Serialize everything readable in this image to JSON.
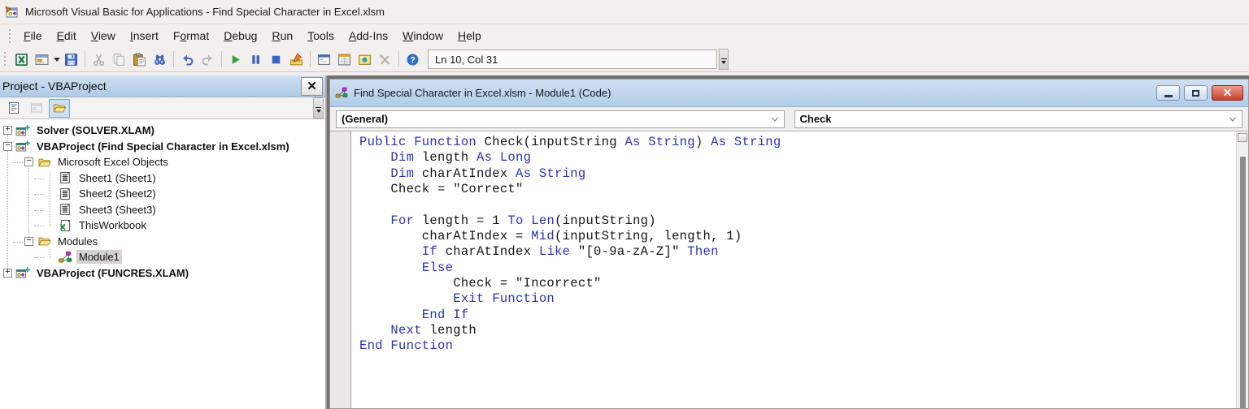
{
  "window": {
    "title": "Microsoft Visual Basic for Applications - Find Special Character in Excel.xlsm"
  },
  "menu": {
    "items": [
      {
        "label": "File",
        "mnemonic": 0
      },
      {
        "label": "Edit",
        "mnemonic": 0
      },
      {
        "label": "View",
        "mnemonic": 0
      },
      {
        "label": "Insert",
        "mnemonic": 0
      },
      {
        "label": "Format",
        "mnemonic": 1
      },
      {
        "label": "Debug",
        "mnemonic": 0
      },
      {
        "label": "Run",
        "mnemonic": 0
      },
      {
        "label": "Tools",
        "mnemonic": 0
      },
      {
        "label": "Add-Ins",
        "mnemonic": 0
      },
      {
        "label": "Window",
        "mnemonic": 0
      },
      {
        "label": "Help",
        "mnemonic": 0
      }
    ]
  },
  "toolbar": {
    "position_indicator": "Ln 10, Col 31",
    "buttons": [
      {
        "name": "view-excel",
        "icon": "excel",
        "enabled": true
      },
      {
        "name": "insert-userform",
        "icon": "userform",
        "enabled": true,
        "dropdown": true
      },
      {
        "name": "save",
        "icon": "save",
        "enabled": true
      },
      {
        "sep": true
      },
      {
        "name": "cut",
        "icon": "cut",
        "enabled": false
      },
      {
        "name": "copy",
        "icon": "copy",
        "enabled": false
      },
      {
        "name": "paste",
        "icon": "paste",
        "enabled": true
      },
      {
        "name": "find",
        "icon": "find",
        "enabled": true
      },
      {
        "sep": true
      },
      {
        "name": "undo",
        "icon": "undo",
        "enabled": true
      },
      {
        "name": "redo",
        "icon": "redo",
        "enabled": false
      },
      {
        "sep": true
      },
      {
        "name": "run-macro",
        "icon": "run",
        "enabled": true
      },
      {
        "name": "break",
        "icon": "break",
        "enabled": true
      },
      {
        "name": "reset",
        "icon": "stop",
        "enabled": true
      },
      {
        "name": "design-mode",
        "icon": "design",
        "enabled": true
      },
      {
        "sep": true
      },
      {
        "name": "project-explorer",
        "icon": "projexp",
        "enabled": true
      },
      {
        "name": "properties-window",
        "icon": "props",
        "enabled": true
      },
      {
        "name": "object-browser",
        "icon": "objbrowser",
        "enabled": true
      },
      {
        "name": "toolbox",
        "icon": "toolbox",
        "enabled": false
      },
      {
        "sep": true
      },
      {
        "name": "help",
        "icon": "help",
        "enabled": true
      }
    ]
  },
  "project_panel": {
    "header": {
      "title": "Project - VBAProject"
    },
    "toolbar": {
      "buttons": [
        {
          "name": "view-code",
          "icon": "viewcode",
          "enabled": true,
          "active": false
        },
        {
          "name": "view-object",
          "icon": "viewobject",
          "enabled": false,
          "active": false
        },
        {
          "name": "toggle-folders",
          "icon": "folder",
          "enabled": true,
          "active": true
        }
      ]
    },
    "tree": [
      {
        "depth": 0,
        "expand": "+",
        "icon": "project",
        "label": "Solver (SOLVER.XLAM)",
        "bold": true
      },
      {
        "depth": 0,
        "expand": "-",
        "icon": "project",
        "label": "VBAProject (Find Special Character in Excel.xlsm)",
        "bold": true
      },
      {
        "depth": 1,
        "expand": "-",
        "icon": "folder",
        "label": "Microsoft Excel Objects",
        "bold": false
      },
      {
        "depth": 2,
        "expand": "",
        "icon": "sheet",
        "label": "Sheet1 (Sheet1)",
        "bold": false
      },
      {
        "depth": 2,
        "expand": "",
        "icon": "sheet",
        "label": "Sheet2 (Sheet2)",
        "bold": false
      },
      {
        "depth": 2,
        "expand": "",
        "icon": "sheet",
        "label": "Sheet3 (Sheet3)",
        "bold": false
      },
      {
        "depth": 2,
        "expand": "",
        "icon": "workbook",
        "label": "ThisWorkbook",
        "bold": false
      },
      {
        "depth": 1,
        "expand": "-",
        "icon": "folder",
        "label": "Modules",
        "bold": false
      },
      {
        "depth": 2,
        "expand": "",
        "icon": "module",
        "label": "Module1",
        "bold": false,
        "selected": true
      },
      {
        "depth": 0,
        "expand": "+",
        "icon": "project",
        "label": "VBAProject (FUNCRES.XLAM)",
        "bold": true
      }
    ]
  },
  "code_window": {
    "title": "Find Special Character in Excel.xlsm - Module1 (Code)",
    "combos": {
      "left": "(General)",
      "right": "Check"
    },
    "code": {
      "lines": [
        [
          [
            "Public Function ",
            "k"
          ],
          [
            "Check(inputString ",
            "n"
          ],
          [
            "As String",
            "k"
          ],
          [
            ") ",
            "n"
          ],
          [
            "As String",
            "k"
          ]
        ],
        [
          [
            "    ",
            "n"
          ],
          [
            "Dim",
            "k"
          ],
          [
            " length ",
            "n"
          ],
          [
            "As Long",
            "k"
          ]
        ],
        [
          [
            "    ",
            "n"
          ],
          [
            "Dim",
            "k"
          ],
          [
            " charAtIndex ",
            "n"
          ],
          [
            "As String",
            "k"
          ]
        ],
        [
          [
            "    Check = \"Correct\"",
            "n"
          ]
        ],
        [],
        [
          [
            "    ",
            "n"
          ],
          [
            "For",
            "k"
          ],
          [
            " length = 1 ",
            "n"
          ],
          [
            "To",
            "k"
          ],
          [
            " ",
            "n"
          ],
          [
            "Len",
            "k"
          ],
          [
            "(inputString)",
            "n"
          ]
        ],
        [
          [
            "        charAtIndex = ",
            "n"
          ],
          [
            "Mid",
            "k"
          ],
          [
            "(inputString, length, 1)",
            "n"
          ]
        ],
        [
          [
            "        ",
            "n"
          ],
          [
            "If",
            "k"
          ],
          [
            " charAtIndex ",
            "n"
          ],
          [
            "Like",
            "k"
          ],
          [
            " \"[0-9a-zA-Z]\" ",
            "n"
          ],
          [
            "Then",
            "k"
          ]
        ],
        [
          [
            "        ",
            "n"
          ],
          [
            "Else",
            "k"
          ]
        ],
        [
          [
            "            Check = \"Incorrect\"",
            "n"
          ]
        ],
        [
          [
            "            ",
            "n"
          ],
          [
            "Exit Function",
            "k"
          ]
        ],
        [
          [
            "        ",
            "n"
          ],
          [
            "End If",
            "k"
          ]
        ],
        [
          [
            "    ",
            "n"
          ],
          [
            "Next",
            "k"
          ],
          [
            " length",
            "n"
          ]
        ],
        [
          [
            "End Function",
            "k"
          ]
        ]
      ]
    }
  }
}
